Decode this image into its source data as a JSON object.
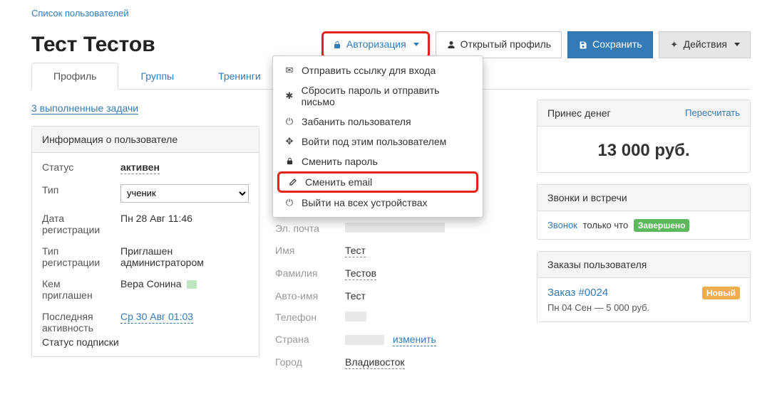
{
  "breadcrumb": "Список пользователей",
  "page_title": "Тест Тестов",
  "header_buttons": {
    "auth": "Авторизация",
    "public": "Открытый профиль",
    "save": "Сохранить",
    "actions": "Действия"
  },
  "tabs": {
    "profile": "Профиль",
    "groups": "Группы",
    "trainings": "Тренинги"
  },
  "tasks_link": "3 выполненные задачи",
  "info_panel": {
    "heading": "Информация о пользователе",
    "status_label": "Статус",
    "status_value": "активен",
    "type_label": "Тип",
    "type_select": "ученик",
    "reg_date_label": "Дата регистрации",
    "reg_date_value": "Пн 28 Авг 11:46",
    "reg_type_label": "Тип регистрации",
    "reg_type_value": "Приглашен администратором",
    "invited_by_label": "Кем приглашен",
    "invited_by_value": "Вера Сонина",
    "last_act_label": "Последняя активность",
    "last_act_value": "Ср 30 Авг 01:03",
    "sub_status_label": "Статус подписки"
  },
  "dropdown": {
    "send_link": "Отправить ссылку для входа",
    "reset_pw": "Сбросить пароль и отправить письмо",
    "ban": "Забанить пользователя",
    "login_as": "Войти под этим пользователем",
    "change_pw": "Сменить пароль",
    "change_email": "Сменить email",
    "logout_all": "Выйти на всех устройствах"
  },
  "mid": {
    "name_title": "Тест Тестов",
    "email_label": "Эл. почта",
    "first_label": "Имя",
    "first_value": "Тест",
    "last_label": "Фамилия",
    "last_value": "Тестов",
    "auto_label": "Авто-имя",
    "auto_value": "Тест",
    "phone_label": "Телефон",
    "country_label": "Страна",
    "country_value": "изменить",
    "city_label": "Город",
    "city_value": "Владивосток"
  },
  "money_panel": {
    "heading": "Принес денег",
    "recalc": "Пересчитать",
    "amount": "13 000 руб."
  },
  "calls_panel": {
    "heading": "Звонки и встречи",
    "call_link": "Звонок",
    "when": "только что",
    "status": "Завершено"
  },
  "orders_panel": {
    "heading": "Заказы пользователя",
    "order_title": "Заказ #0024",
    "order_badge": "Новый",
    "order_line": "Пн 04 Сен — 5 000 руб."
  }
}
